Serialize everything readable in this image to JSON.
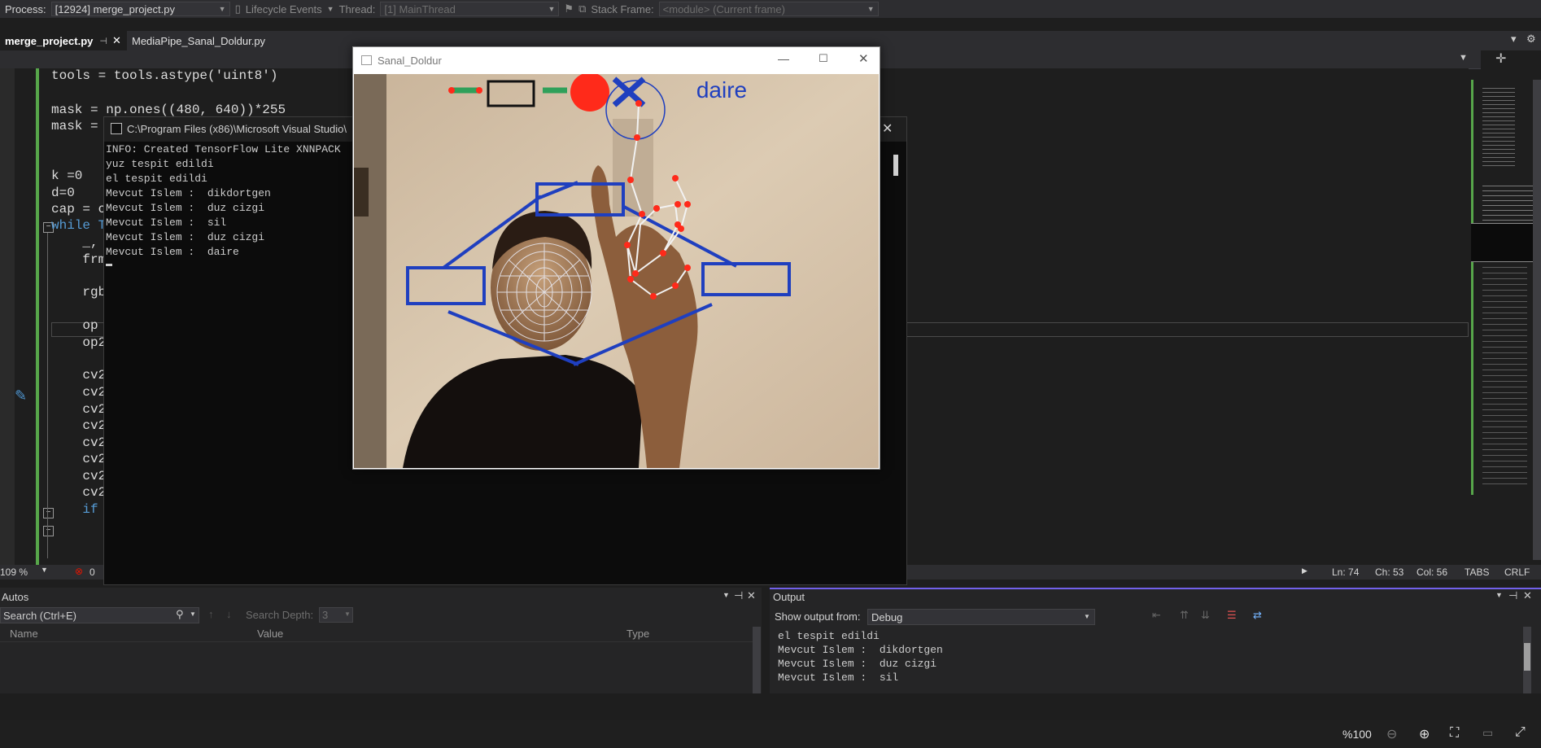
{
  "debugbar": {
    "process_label": "Process:",
    "process_value": "[12924] merge_project.py",
    "lifecycle": "Lifecycle Events",
    "thread_label": "Thread:",
    "thread_value": "[1] MainThread",
    "stack_label": "Stack Frame:",
    "stack_value": "<module> (Current frame)"
  },
  "tabs": [
    {
      "label": "merge_project.py",
      "active": true
    },
    {
      "label": "MediaPipe_Sanal_Doldur.py",
      "active": false
    }
  ],
  "code": {
    "lines": [
      "tools = tools.astype('uint8')",
      "mask = np.ones((480, 640))*255",
      "mask = ",
      "k =0",
      "d=0",
      "cap = c",
      "while T",
      "    _,",
      "    frm",
      "    rgb",
      "    op",
      "    op2",
      "    cv2",
      "    cv2",
      "    cv2",
      "    cv2",
      "    cv2",
      "    cv2",
      "    cv2",
      "    cv2",
      "    if"
    ]
  },
  "editor_status": {
    "zoom": "109 %",
    "errors": "0",
    "ln": "Ln: 74",
    "ch": "Ch: 53",
    "col": "Col: 56",
    "tabs": "TABS",
    "crlf": "CRLF"
  },
  "console": {
    "title": "C:\\Program Files (x86)\\Microsoft Visual Studio\\",
    "lines": [
      "INFO: Created TensorFlow Lite XNNPACK",
      "yuz tespit edildi",
      "el tespit edildi",
      "Mevcut Islem :  dikdortgen",
      "Mevcut Islem :  duz cizgi",
      "Mevcut Islem :  sil",
      "Mevcut Islem :  duz cizgi",
      "Mevcut Islem :  daire"
    ]
  },
  "video_window": {
    "title": "Sanal_Doldur",
    "mode_label": "daire",
    "colors": {
      "accent_blue": "#1f3fbf",
      "red": "#ff2a1a",
      "green": "#2fa05a"
    }
  },
  "autos": {
    "title": "Autos",
    "search_placeholder": "Search (Ctrl+E)",
    "depth_label": "Search Depth:",
    "depth_value": "3",
    "columns": [
      "Name",
      "Value",
      "Type"
    ]
  },
  "output": {
    "title": "Output",
    "show_label": "Show output from:",
    "source": "Debug",
    "lines": [
      "el tespit edildi",
      "Mevcut Islem :  dikdortgen",
      "Mevcut Islem :  duz cizgi",
      "Mevcut Islem :  sil"
    ]
  },
  "bottombar": {
    "zoom": "%100"
  }
}
